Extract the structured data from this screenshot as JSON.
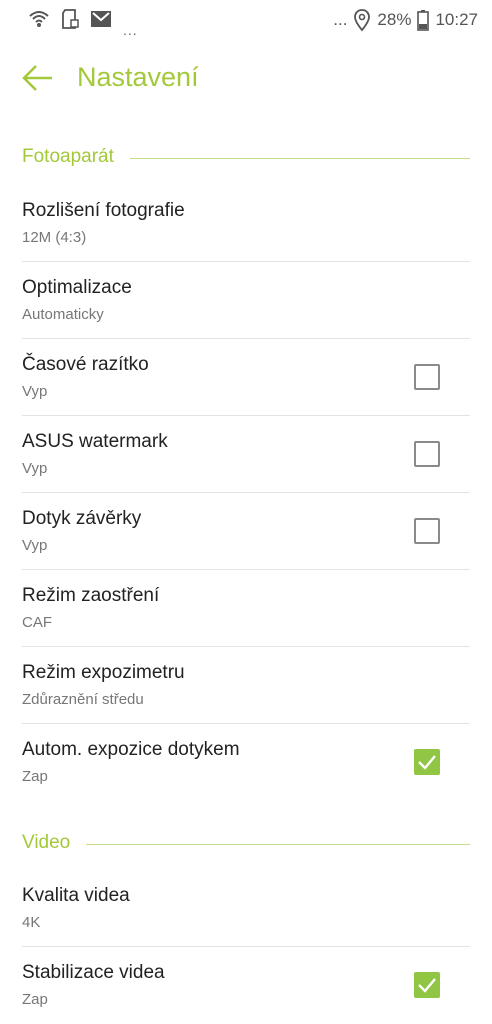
{
  "status_bar": {
    "more_indicator": "...",
    "overflow_dots": "...",
    "battery": "28%",
    "time": "10:27"
  },
  "header": {
    "title": "Nastavení"
  },
  "sections": {
    "camera": "Fotoaparát",
    "video": "Video"
  },
  "settings": {
    "photo_resolution": {
      "title": "Rozlišení fotografie",
      "value": "12M (4:3)"
    },
    "optimization": {
      "title": "Optimalizace",
      "value": "Automaticky"
    },
    "timestamp": {
      "title": "Časové razítko",
      "value": "Vyp",
      "checked": false
    },
    "asus_watermark": {
      "title": "ASUS watermark",
      "value": "Vyp",
      "checked": false
    },
    "touch_shutter": {
      "title": "Dotyk závěrky",
      "value": "Vyp",
      "checked": false
    },
    "focus_mode": {
      "title": "Režim zaostření",
      "value": "CAF"
    },
    "metering_mode": {
      "title": "Režim expozimetru",
      "value": "Zdůraznění středu"
    },
    "touch_auto_exposure": {
      "title": "Autom. expozice dotykem",
      "value": "Zap",
      "checked": true
    },
    "video_quality": {
      "title": "Kvalita videa",
      "value": "4K"
    },
    "video_stabilization": {
      "title": "Stabilizace videa",
      "value": "Zap",
      "checked": true
    }
  },
  "colors": {
    "accent": "#a3c93a",
    "checkbox_checked": "#91c544"
  },
  "icons": {
    "status_left": [
      "wifi-icon",
      "sd-card-icon",
      "gmail-icon"
    ],
    "status_right": [
      "location-icon",
      "battery-icon"
    ],
    "header": "back-arrow-icon"
  }
}
